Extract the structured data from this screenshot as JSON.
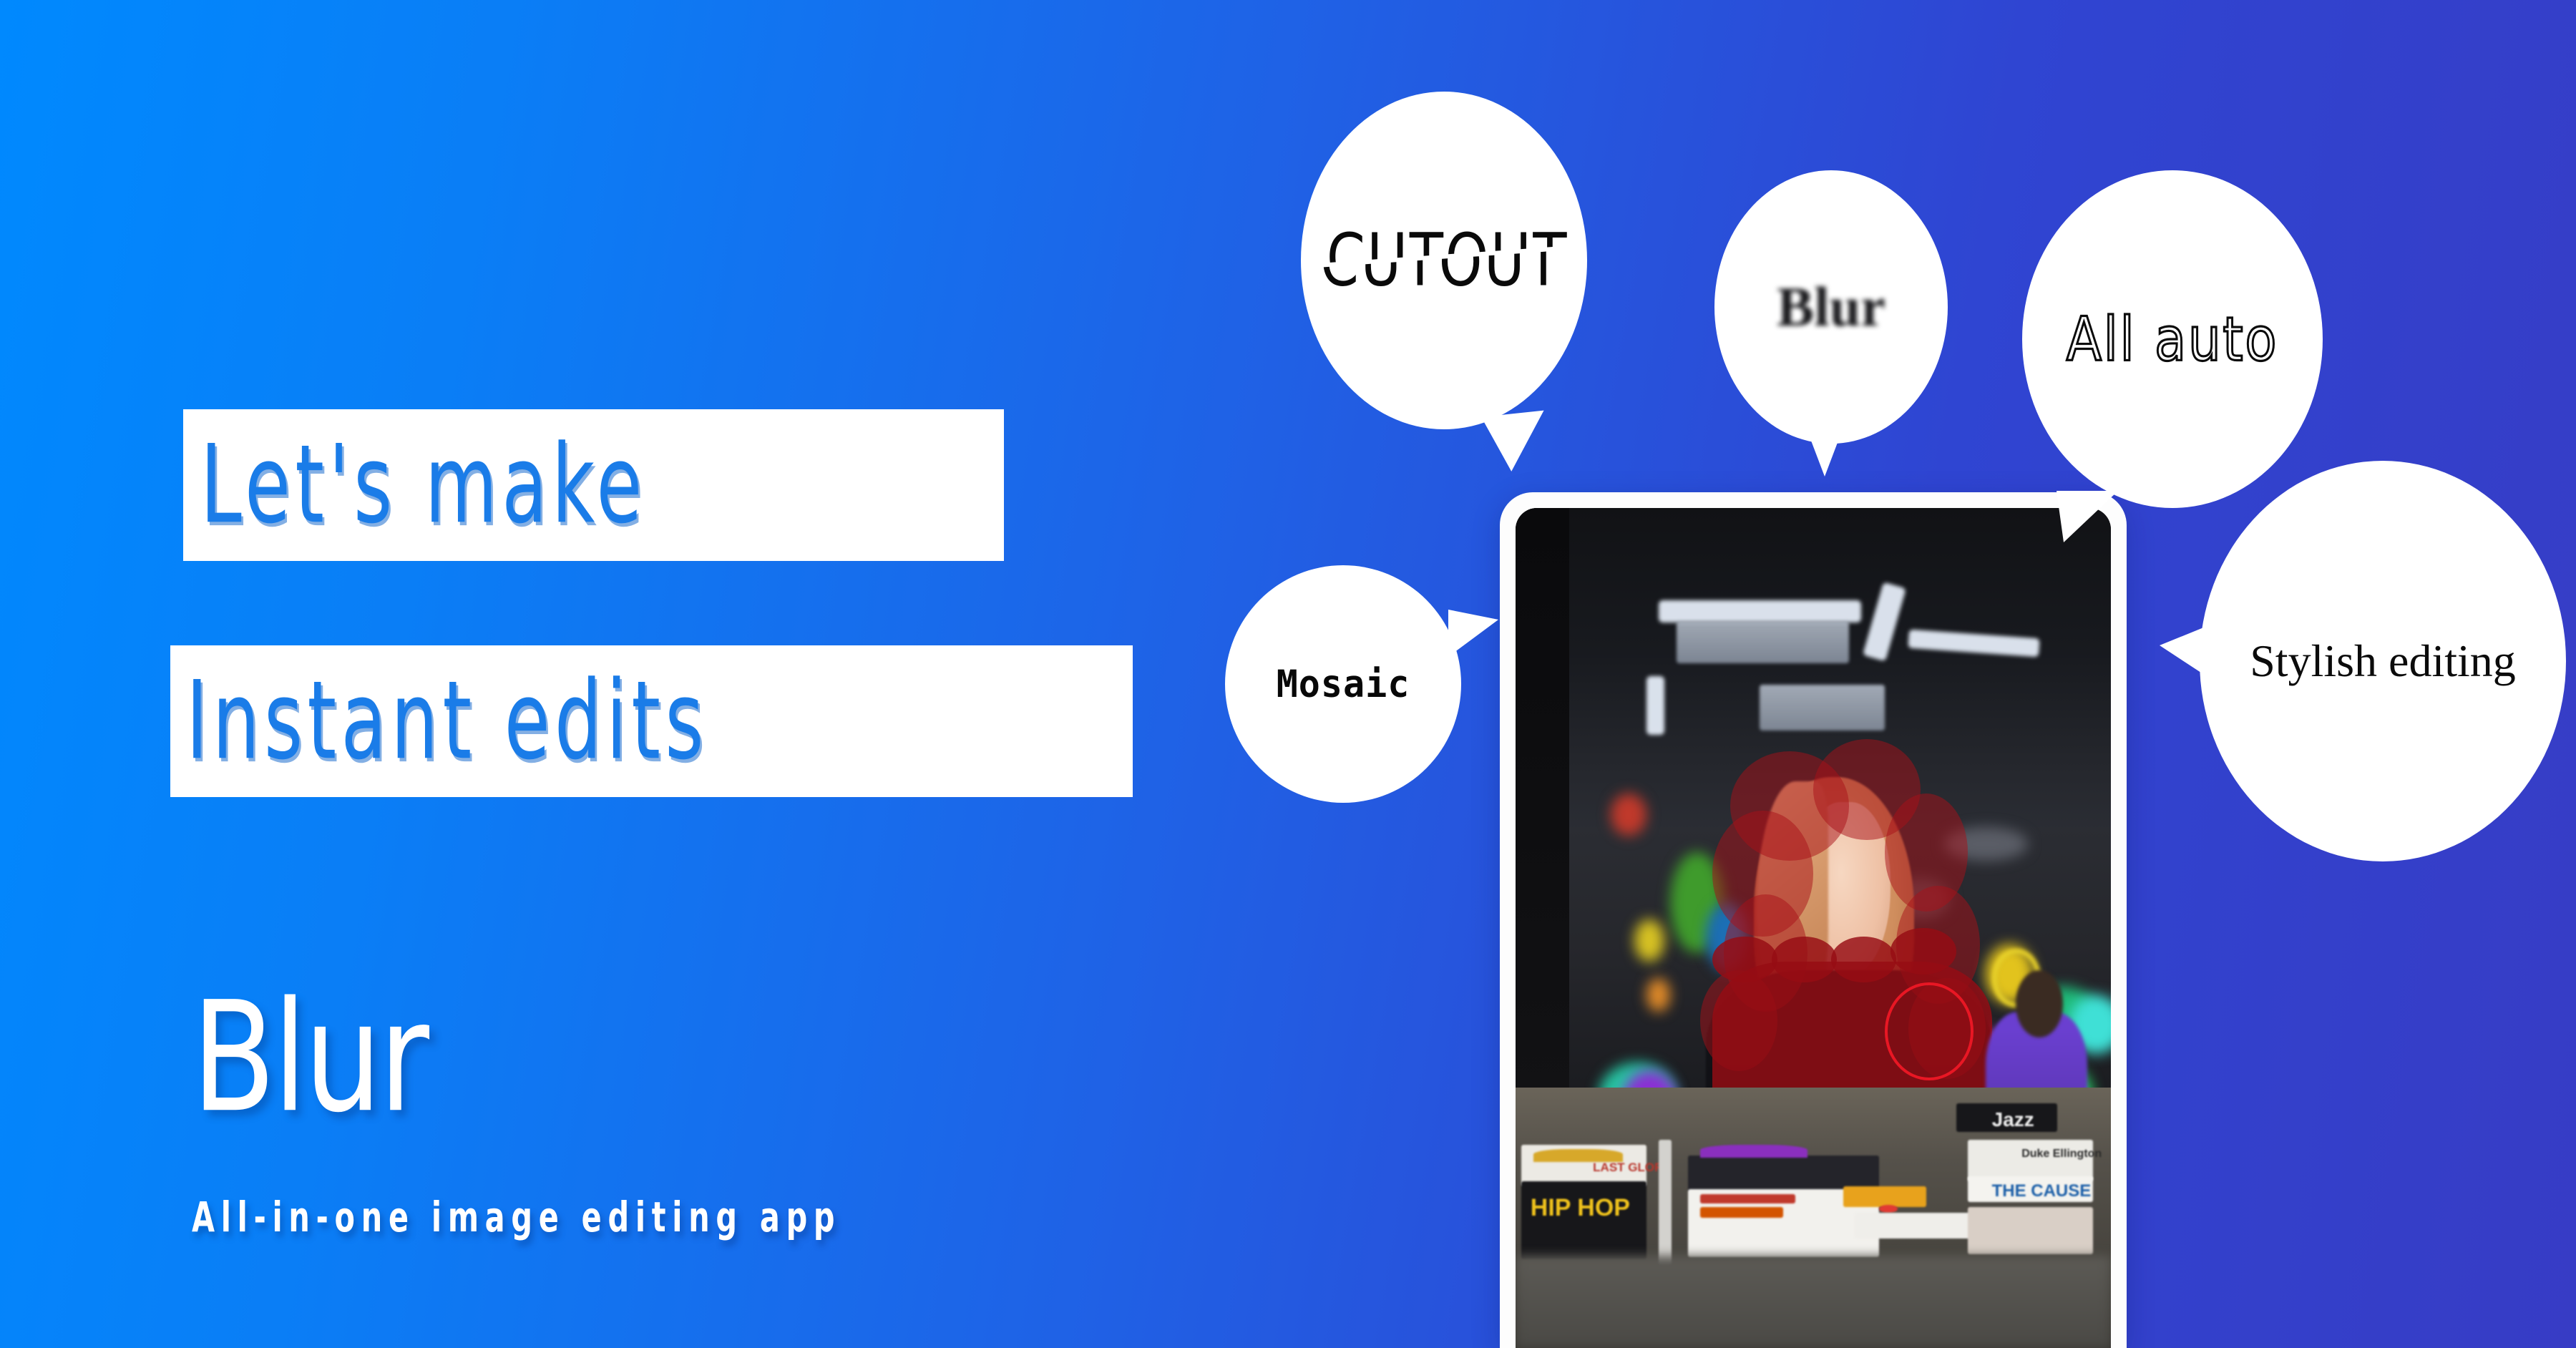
{
  "background": {
    "gradient_from": "#0089FE",
    "gradient_to": "#373CC5"
  },
  "hero": {
    "headline_line1": "Let's make",
    "headline_line2": "Instant edits",
    "headline_color": "#1a7ce8",
    "headline_bg": "#ffffff"
  },
  "brand": {
    "name": "Blur",
    "tagline": "All-in-one image editing app",
    "color": "#ffffff"
  },
  "bubbles": [
    {
      "id": "cutout",
      "label": "CUTOUT",
      "style": "sliced-sans",
      "tail": "bottom"
    },
    {
      "id": "blur",
      "label": "Blur",
      "style": "blurred-serif",
      "tail": "bottom"
    },
    {
      "id": "allauto",
      "label": "All auto",
      "style": "outline-sans",
      "tail": "bottom-left"
    },
    {
      "id": "stylish",
      "label": "Stylish editing",
      "style": "serif",
      "tail": "left"
    },
    {
      "id": "mosaic",
      "label": "Mosaic",
      "style": "pixel-mono",
      "tail": "right"
    }
  ],
  "phone": {
    "frame_color": "#fdfdfd",
    "preview_alt": "Woman in record store with red cutout selection mask",
    "selection_mask_color": "#960c14",
    "selection_outline_color": "#e81724",
    "crate_labels": [
      "HIP HOP",
      "Jazz",
      "THE CAUSE",
      "LAST GLORY",
      "Duke Ellington"
    ]
  }
}
